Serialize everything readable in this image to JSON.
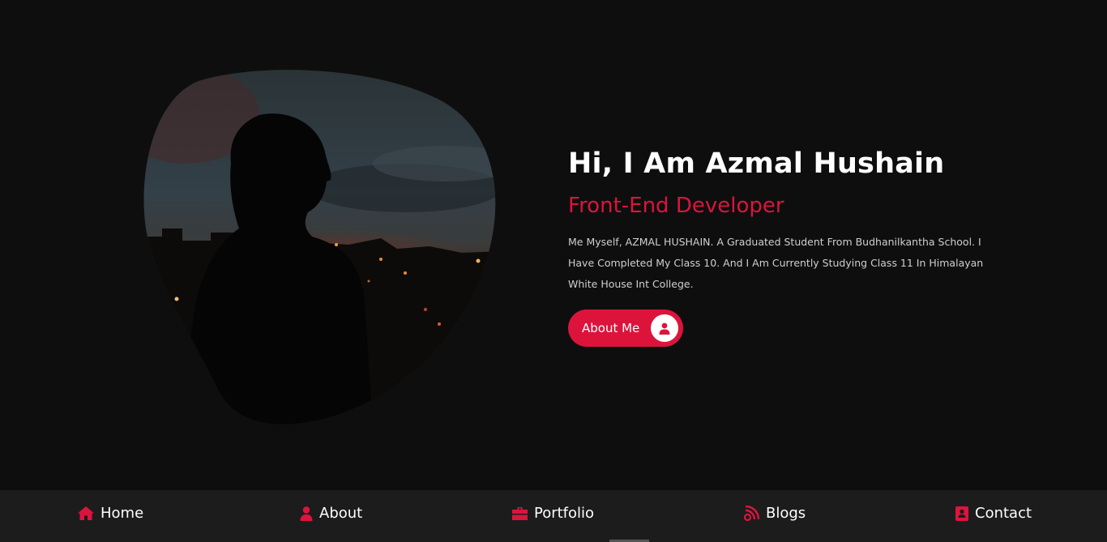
{
  "hero": {
    "heading": "Hi, I Am Azmal Hushain",
    "role": "Front-End Developer",
    "bio": "Me Myself, AZMAL HUSHAIN. A Graduated Student From Budhanilkantha School. I Have Completed My Class 10. And I Am Currently Studying Class 11 In Himalayan White House Int College.",
    "button_label": "About Me",
    "button_icon": "user-icon"
  },
  "nav": {
    "items": [
      {
        "label": "Home",
        "icon": "home-icon"
      },
      {
        "label": "About",
        "icon": "user-icon"
      },
      {
        "label": "Portfolio",
        "icon": "briefcase-icon"
      },
      {
        "label": "Blogs",
        "icon": "blog-icon"
      },
      {
        "label": "Contact",
        "icon": "contact-book-icon"
      }
    ]
  },
  "colors": {
    "background": "#0e0e0f",
    "accent": "#dc143c",
    "nav_background": "#1c1c1d",
    "text": "#ffffff"
  }
}
